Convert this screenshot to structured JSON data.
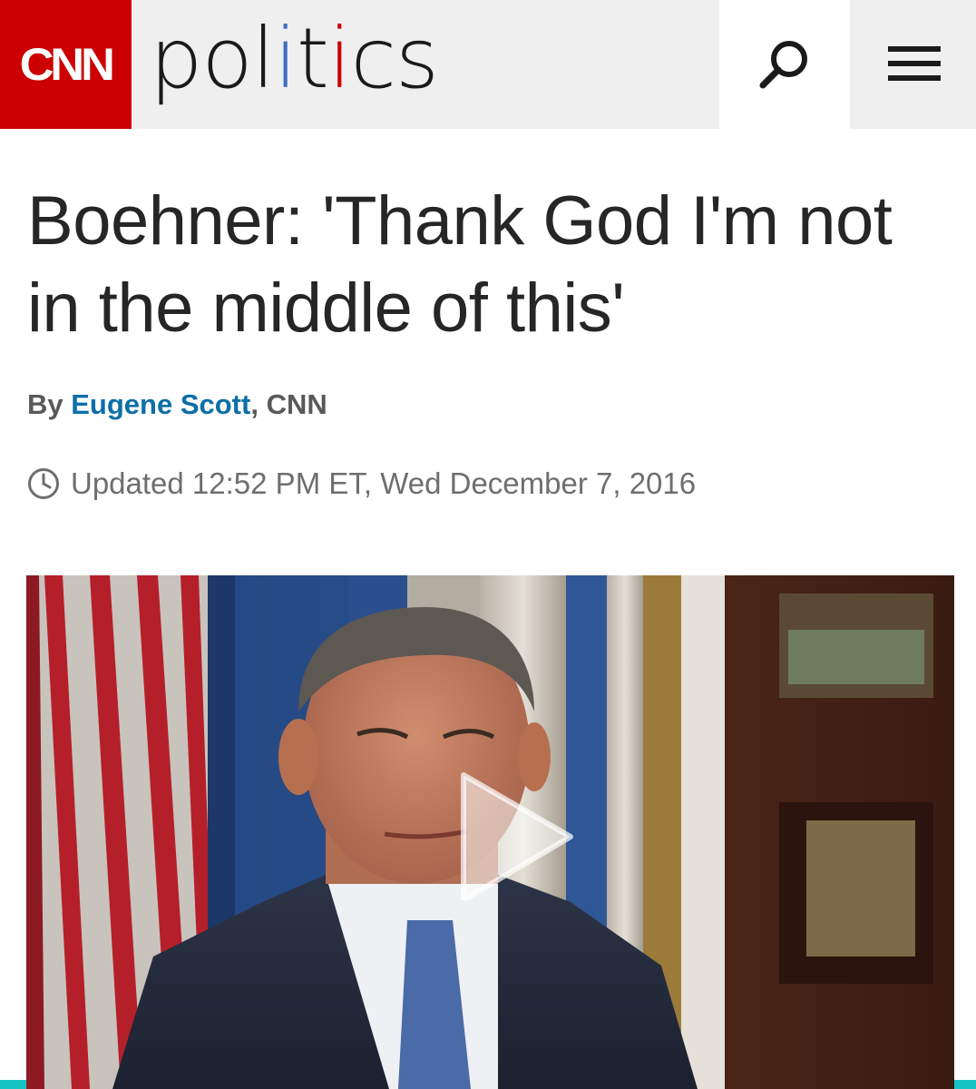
{
  "header": {
    "logo": "CNN",
    "section_parts": [
      "pol",
      "i",
      "t",
      "i",
      "cs"
    ],
    "search_icon": "search-icon",
    "menu_icon": "hamburger-menu-icon",
    "brand_red": "#cc0000",
    "accent_blue": "#3f6dc2"
  },
  "article": {
    "headline": "Boehner: 'Thank God I'm not in the middle of this'",
    "byline_prefix": "By ",
    "author": "Eugene Scott",
    "byline_suffix": ", CNN",
    "timestamp": "Updated 12:52 PM ET, Wed December 7, 2016",
    "author_color": "#0c6fa8"
  },
  "video": {
    "play_icon": "play-icon"
  }
}
